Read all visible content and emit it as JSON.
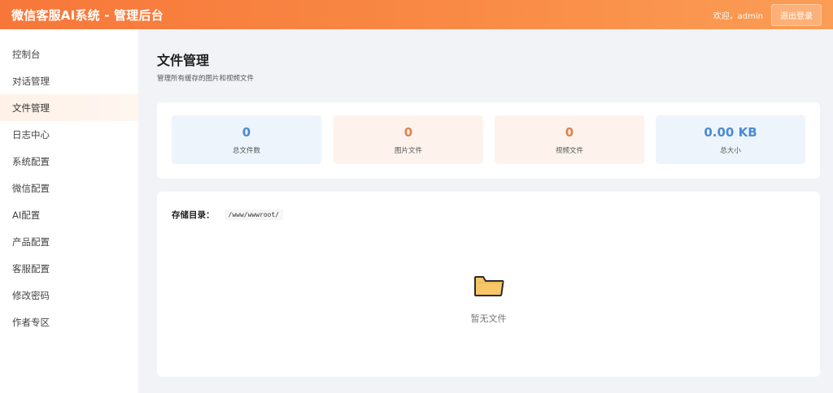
{
  "header": {
    "title": "微信客服AI系统 - 管理后台",
    "welcome": "欢迎，admin",
    "logout_label": "退出登录",
    "colors": {
      "gradient_start": "#f7773a",
      "gradient_end": "#fb9d55"
    }
  },
  "sidebar": {
    "items": [
      {
        "label": "控制台"
      },
      {
        "label": "对话管理"
      },
      {
        "label": "文件管理",
        "active": true
      },
      {
        "label": "日志中心"
      },
      {
        "label": "系统配置"
      },
      {
        "label": "微信配置"
      },
      {
        "label": "AI配置"
      },
      {
        "label": "产品配置"
      },
      {
        "label": "客服配置"
      },
      {
        "label": "修改密码"
      },
      {
        "label": "作者专区"
      }
    ]
  },
  "main": {
    "title": "文件管理",
    "subtitle": "管理所有缓存的图片和视频文件",
    "stats": [
      {
        "value": "0",
        "label": "总文件数",
        "color": "#4a8bd2"
      },
      {
        "value": "0",
        "label": "图片文件",
        "color": "#e2804e"
      },
      {
        "value": "0",
        "label": "视频文件",
        "color": "#e2804e"
      },
      {
        "value": "0.00 KB",
        "label": "总大小",
        "color": "#4a8bd2"
      }
    ],
    "storage": {
      "label": "存储目录：",
      "path": "/www/wwwroot/"
    },
    "empty": {
      "icon": "folder-icon",
      "text": "暂无文件"
    }
  }
}
